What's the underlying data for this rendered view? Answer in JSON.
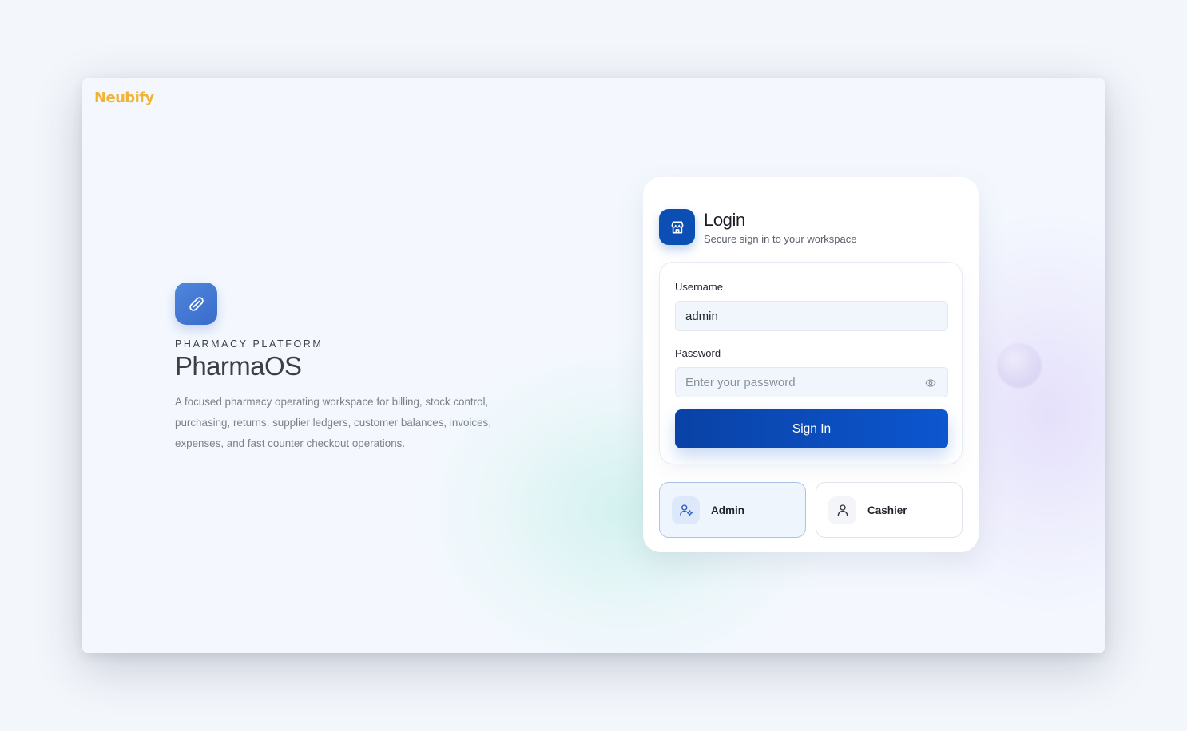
{
  "brand": {
    "name": "Neubify",
    "color": "#f0b333"
  },
  "hero": {
    "icon": "pill-icon",
    "eyebrow": "PHARMACY PLATFORM",
    "title": "PharmaOS",
    "description": "A focused pharmacy operating workspace for billing, stock control, purchasing, returns, supplier ledgers, customer balances, invoices, expenses, and fast counter checkout operations."
  },
  "login": {
    "icon": "store-icon",
    "title": "Login",
    "subtitle": "Secure sign in to your workspace",
    "username": {
      "label": "Username",
      "value": "admin"
    },
    "password": {
      "label": "Password",
      "placeholder": "Enter your password",
      "toggle_icon": "eye-icon"
    },
    "submit_label": "Sign In",
    "accent": "#0b4fb5"
  },
  "roles": [
    {
      "label": "Admin",
      "icon": "user-cog-icon",
      "selected": true
    },
    {
      "label": "Cashier",
      "icon": "user-icon",
      "selected": false
    }
  ]
}
